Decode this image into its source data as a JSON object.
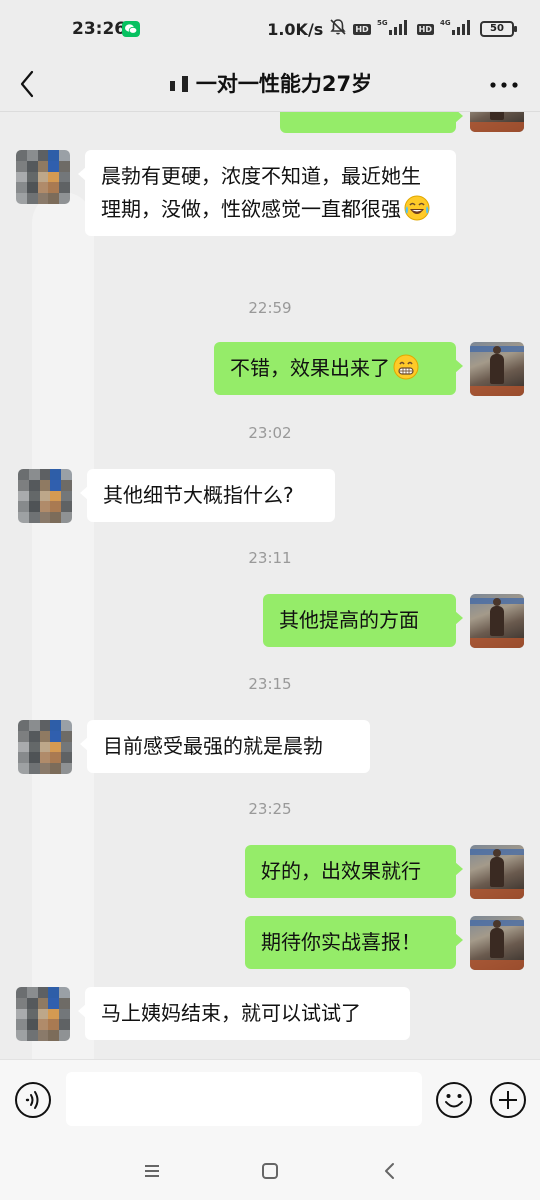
{
  "status_bar": {
    "time": "23:26",
    "net_speed": "1.0K/s",
    "signal_1": "5G",
    "signal_2": "4G",
    "hd": "HD",
    "battery": "50"
  },
  "header": {
    "title": "一对一性能力27岁"
  },
  "messages": [
    {
      "type": "bubble",
      "side": "in",
      "text": "晨勃有更硬，浓度不知道，最近她生理期，没做，性欲感觉一直都很强",
      "emoji": "tears-of-joy-emoji"
    },
    {
      "type": "time",
      "text": "22:59"
    },
    {
      "type": "bubble",
      "side": "out",
      "text": "不错，效果出来了",
      "emoji": "grinning-emoji"
    },
    {
      "type": "time",
      "text": "23:02"
    },
    {
      "type": "bubble",
      "side": "in",
      "text": "其他细节大概指什么?"
    },
    {
      "type": "time",
      "text": "23:11"
    },
    {
      "type": "bubble",
      "side": "out",
      "text": "其他提高的方面"
    },
    {
      "type": "time",
      "text": "23:15"
    },
    {
      "type": "bubble",
      "side": "in",
      "text": "目前感受最强的就是晨勃"
    },
    {
      "type": "time",
      "text": "23:25"
    },
    {
      "type": "bubble",
      "side": "out",
      "text": "好的，出效果就行"
    },
    {
      "type": "bubble",
      "side": "out",
      "text": "期待你实战喜报！"
    },
    {
      "type": "bubble",
      "side": "in",
      "text": "马上姨妈结束，就可以试试了"
    }
  ],
  "input_bar": {
    "value": "",
    "icons": [
      "voice-icon",
      "emoji-icon",
      "plus-icon"
    ]
  },
  "colors": {
    "outgoing_bubble": "#95ec69",
    "incoming_bubble": "#ffffff",
    "background": "#ededed",
    "wechat_green": "#07c160"
  }
}
